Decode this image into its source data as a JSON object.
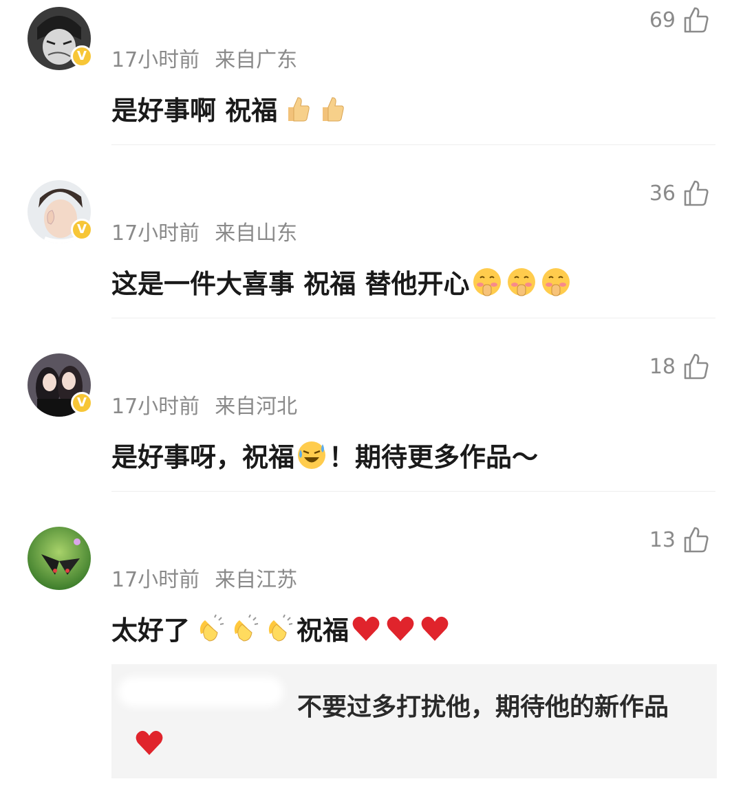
{
  "comments": [
    {
      "time": "17小时前",
      "location": "来自广东",
      "likes": "69",
      "text": "是好事啊 祝福",
      "emojis": [
        "thumbs-up",
        "thumbs-up"
      ]
    },
    {
      "time": "17小时前",
      "location": "来自山东",
      "likes": "36",
      "text": "这是一件大喜事 祝福 替他开心",
      "emojis": [
        "shush-face",
        "shush-face",
        "shush-face"
      ]
    },
    {
      "time": "17小时前",
      "location": "来自河北",
      "likes": "18",
      "text": "是好事呀，祝福",
      "emoji_mid": "tears-of-joy",
      "text_after": "！期待更多作品～"
    },
    {
      "time": "17小时前",
      "location": "来自江苏",
      "likes": "13",
      "text": "太好了",
      "emojis": [
        "clapping",
        "clapping",
        "clapping"
      ],
      "text_after": "祝福",
      "emojis_after": [
        "heart",
        "heart",
        "heart"
      ]
    }
  ],
  "reply": {
    "text": "不要过多打扰他，期待他的新作品",
    "emojis": [
      "heart"
    ]
  },
  "icons": {
    "like": "thumbs-up-outline-icon",
    "verified": "verified-badge-icon"
  },
  "badge_letter": "V",
  "colors": {
    "badge": "#f7c637",
    "meta": "#8a8a8a",
    "heart": "#e0242c"
  }
}
